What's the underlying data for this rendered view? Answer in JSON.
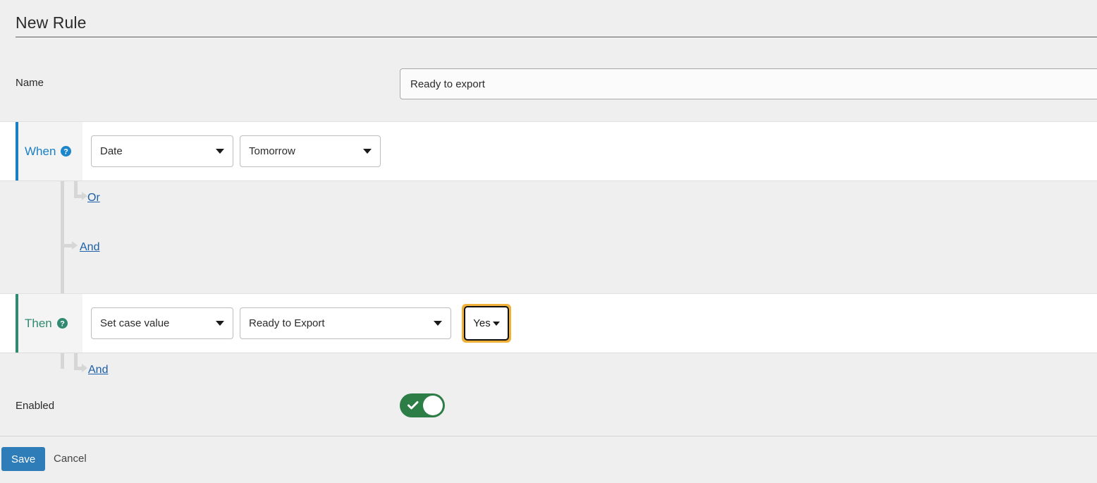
{
  "page": {
    "title": "New Rule"
  },
  "form": {
    "name_label": "Name",
    "name_value": "Ready to export",
    "name_placeholder": "Name"
  },
  "when_block": {
    "label": "When",
    "help_icon": "help-circle-icon",
    "field_dropdown": "Date",
    "value_dropdown": "Tomorrow",
    "or_link": "Or",
    "and_link": "And"
  },
  "then_block": {
    "label": "Then",
    "help_icon": "help-circle-icon",
    "action_dropdown": "Set case value",
    "field_dropdown": "Ready to Export",
    "value_dropdown": "Yes",
    "and_link": "And"
  },
  "enabled": {
    "label": "Enabled",
    "state": "on",
    "icon": "check-icon"
  },
  "footer": {
    "save_label": "Save",
    "cancel_label": "Cancel"
  },
  "colors": {
    "when_accent": "#1b7fc4",
    "then_accent": "#2f8a70",
    "link": "#1b5fa8",
    "toggle_on": "#2d7d46",
    "save_button": "#2e7cb8",
    "focus_ring": "#f0b13b",
    "page_background": "#efefef"
  }
}
